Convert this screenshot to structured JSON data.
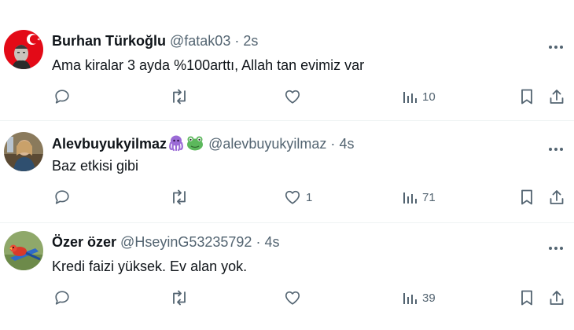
{
  "tweets": [
    {
      "name": "Burhan Türkoğlu",
      "handle": "@fatak03",
      "time": "2s",
      "text": "Ama kiralar 3 ayda %100arttı, Allah tan evimiz var",
      "replies": "",
      "retweets": "",
      "likes": "",
      "views": "10",
      "avatar_icon": "ataturk-flag-avatar"
    },
    {
      "name": "Alevbuyukyilmaz",
      "handle": "@alevbuyukyilmaz",
      "time": "4s",
      "text": "Baz etkisi gibi",
      "replies": "",
      "retweets": "",
      "likes": "1",
      "views": "71",
      "avatar_icon": "photo-avatar",
      "name_emojis": [
        "octopus-emoji",
        "frog-emoji"
      ]
    },
    {
      "name": "Özer özer",
      "handle": "@HseyinG53235792",
      "time": "4s",
      "text": "Kredi faizi yüksek. Ev alan yok.",
      "replies": "",
      "retweets": "",
      "likes": "",
      "views": "39",
      "avatar_icon": "parrot-avatar"
    }
  ],
  "separator": "·",
  "colors": {
    "text": "#0f1419",
    "secondary": "#536471",
    "border": "#eff3f4"
  }
}
